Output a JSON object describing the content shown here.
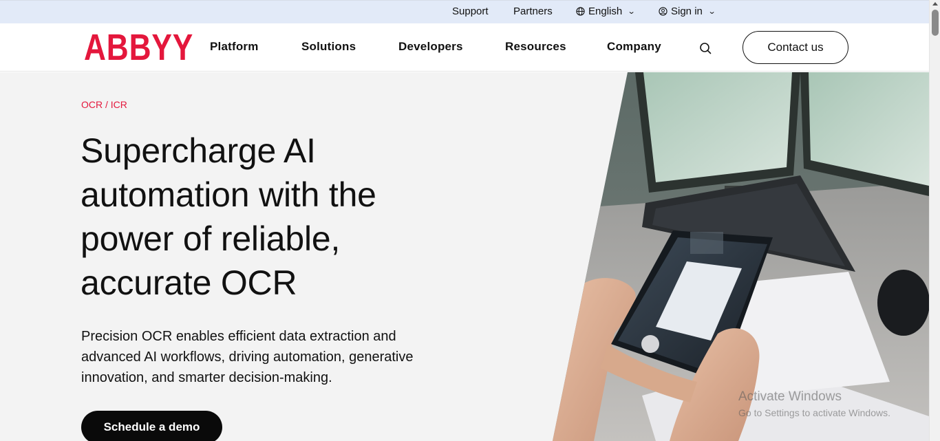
{
  "utility": {
    "support": "Support",
    "partners": "Partners",
    "language": "English",
    "signin": "Sign in"
  },
  "brand": {
    "logo": "ABBYY",
    "color": "#e4173c"
  },
  "nav": {
    "items": [
      "Platform",
      "Solutions",
      "Developers",
      "Resources",
      "Company"
    ],
    "contact": "Contact us",
    "search_icon": "search-icon"
  },
  "hero": {
    "eyebrow": "OCR / ICR",
    "headline": "Supercharge AI automation with the power of reliable, accurate OCR",
    "subtext": "Precision OCR enables efficient data extraction and advanced AI workflows, driving automation, generative innovation, and smarter decision-making.",
    "cta": "Schedule a demo"
  },
  "watermark": {
    "title": "Activate Windows",
    "subtitle": "Go to Settings to activate Windows."
  },
  "colors": {
    "accent": "#e4173c",
    "utility_bar": "#e2eaf8",
    "hero_bg": "#f3f3f3",
    "button_dark": "#0a0a0a"
  }
}
